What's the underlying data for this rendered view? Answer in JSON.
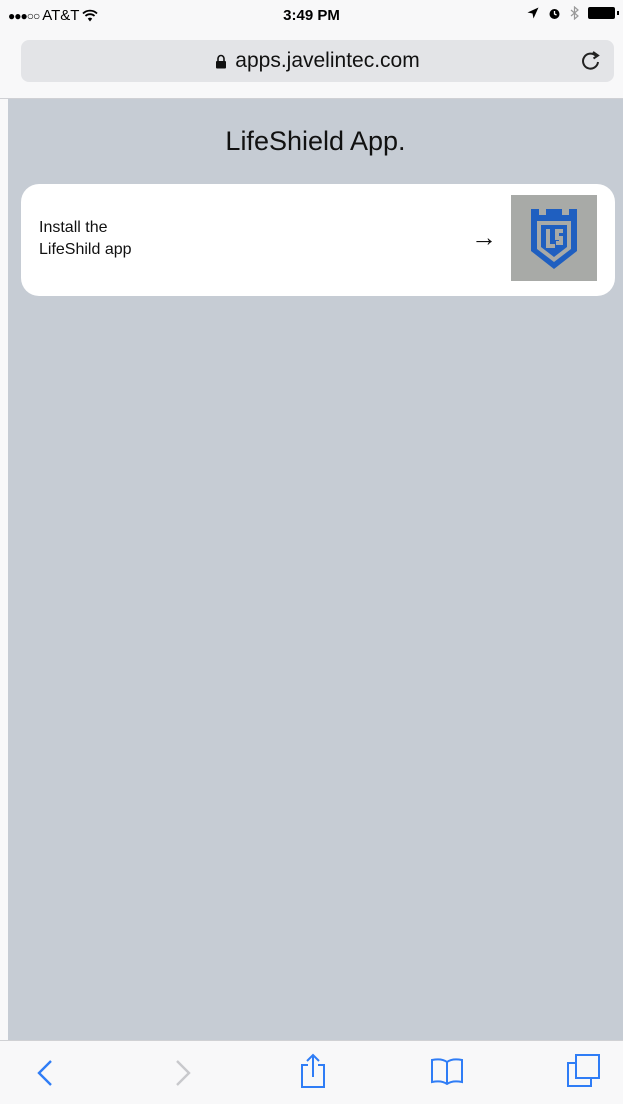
{
  "status_bar": {
    "carrier": "AT&T",
    "time": "3:49 PM"
  },
  "url_bar": {
    "url": "apps.javelintec.com"
  },
  "page": {
    "title": "LifeShield App.",
    "card": {
      "line1": "Install the",
      "line2": "LifeShild app",
      "arrow": "→"
    }
  },
  "colors": {
    "page_background": "#c6ccd4",
    "card_background": "#ffffff",
    "icon_background": "#a8aaa7",
    "logo_blue": "#1f5fc0",
    "toolbar_blue": "#2f7df6"
  },
  "icons": {
    "status": [
      "signal-dots-icon",
      "wifi-icon",
      "location-arrow-icon",
      "alarm-icon",
      "bluetooth-icon",
      "battery-icon"
    ],
    "url_bar": [
      "lock-icon",
      "reload-icon"
    ],
    "toolbar": [
      "back-icon",
      "forward-icon",
      "share-icon",
      "bookmarks-icon",
      "tabs-icon"
    ]
  }
}
